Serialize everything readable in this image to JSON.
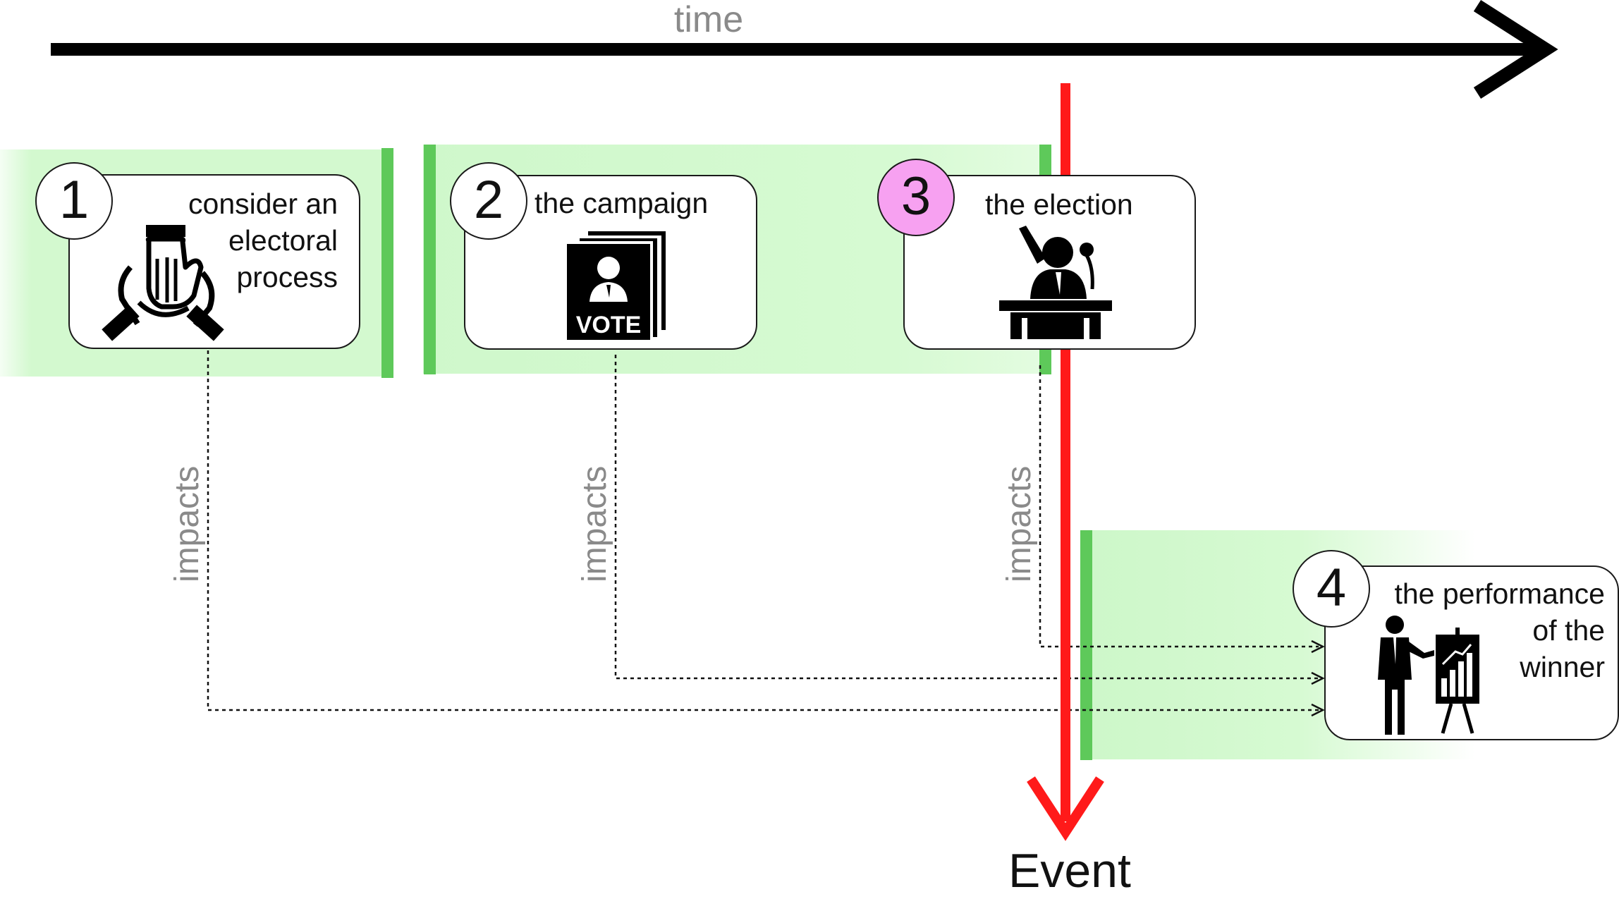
{
  "axis": {
    "label": "time"
  },
  "phases": [
    {
      "number": "1",
      "text_lines": [
        "consider an",
        "electoral",
        "process"
      ],
      "icon": "joined-hands-icon"
    },
    {
      "number": "2",
      "text_lines": [
        "the campaign"
      ],
      "icon": "vote-ballot-icon"
    },
    {
      "number": "3",
      "text_lines": [
        "the election"
      ],
      "icon": "speaker-podium-icon",
      "highlight_color": "#f7a1f1"
    },
    {
      "number": "4",
      "text_lines": [
        "the performance",
        "of the",
        "winner"
      ],
      "icon": "presenter-chart-icon"
    }
  ],
  "relations": {
    "impacts_label": "impacts"
  },
  "event": {
    "label": "Event",
    "color": "#ff0000"
  },
  "colors": {
    "band": "#d6fad2",
    "band_edge": "#5ec95a",
    "axis": "#000000",
    "label_gray": "#8a8a8a"
  }
}
